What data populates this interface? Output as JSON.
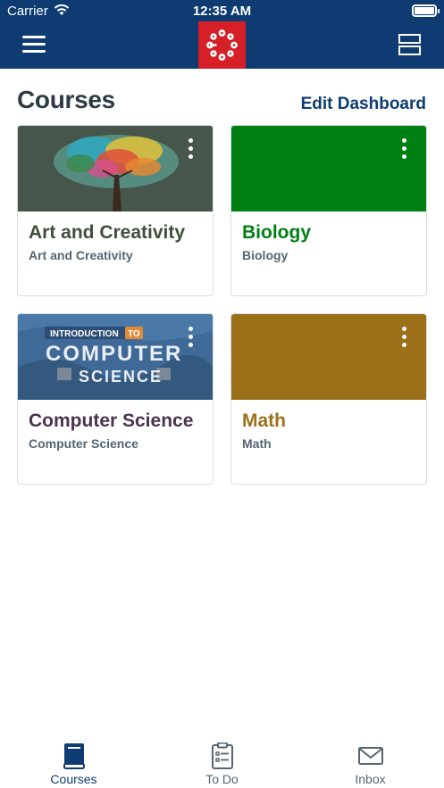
{
  "status_bar": {
    "carrier": "Carrier",
    "time": "12:35 AM"
  },
  "nav": {
    "menu_icon": "hamburger-icon",
    "logo_icon": "canvas-logo-icon",
    "layout_icon": "layout-toggle-icon",
    "bar_color": "#0d3b72",
    "logo_color": "#d62027"
  },
  "page": {
    "title": "Courses",
    "edit_label": "Edit Dashboard"
  },
  "courses": [
    {
      "title": "Art and Creativity",
      "subtitle": "Art and Creativity",
      "color": "#3e4f3a",
      "image": "abstract colorful tree"
    },
    {
      "title": "Biology",
      "subtitle": "Biology",
      "color": "#007f13"
    },
    {
      "title": "Computer Science",
      "subtitle": "Computer Science",
      "color": "#4a3350",
      "banner_small": "INTRODUCTION",
      "banner_to": "TO",
      "banner_line1": "COMPUTER",
      "banner_line2": "SCIENCE"
    },
    {
      "title": "Math",
      "subtitle": "Math",
      "color": "#9b7019"
    }
  ],
  "tabs": [
    {
      "label": "Courses",
      "icon": "book-icon",
      "active": true
    },
    {
      "label": "To Do",
      "icon": "clipboard-icon",
      "active": false
    },
    {
      "label": "Inbox",
      "icon": "envelope-icon",
      "active": false
    }
  ]
}
